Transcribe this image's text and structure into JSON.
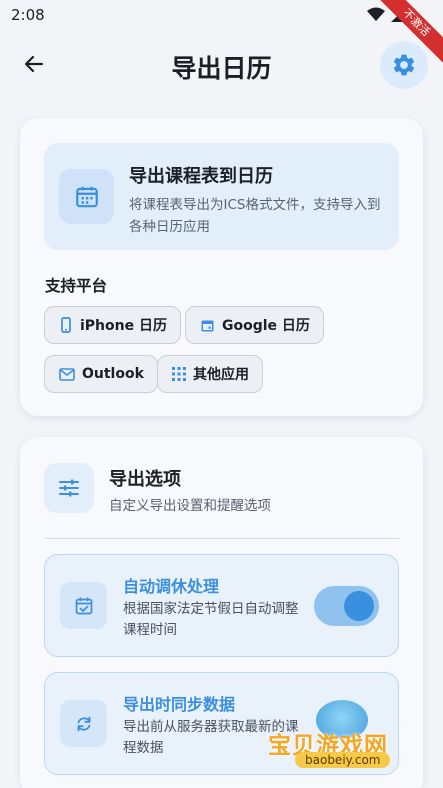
{
  "status_bar": {
    "time": "2:08",
    "debug_label": "不激活"
  },
  "header": {
    "title": "导出日历"
  },
  "export_card": {
    "title": "导出课程表到日历",
    "description": "将课程表导出为ICS格式文件，支持导入到各种日历应用",
    "platforms_label": "支持平台",
    "platforms": [
      {
        "label": "iPhone 日历",
        "icon": "phone-icon"
      },
      {
        "label": "Google 日历",
        "icon": "calendar-icon"
      },
      {
        "label": "Outlook",
        "icon": "mail-icon"
      },
      {
        "label": "其他应用",
        "icon": "apps-grid-icon"
      }
    ]
  },
  "options_card": {
    "title": "导出选项",
    "subtitle": "自定义导出设置和提醒选项",
    "items": [
      {
        "title": "自动调休处理",
        "description": "根据国家法定节假日自动调整课程时间",
        "icon": "calendar-check-icon",
        "toggle_on": true
      },
      {
        "title": "导出时同步数据",
        "description": "导出前从服务器获取最新的课程数据",
        "icon": "sync-icon"
      }
    ]
  },
  "watermark": {
    "text": "宝贝游戏网",
    "url": "baobeiy.com"
  },
  "colors": {
    "accent": "#3b8fe0",
    "accent_light": "#e3eefb",
    "background": "#f2f4f8"
  }
}
